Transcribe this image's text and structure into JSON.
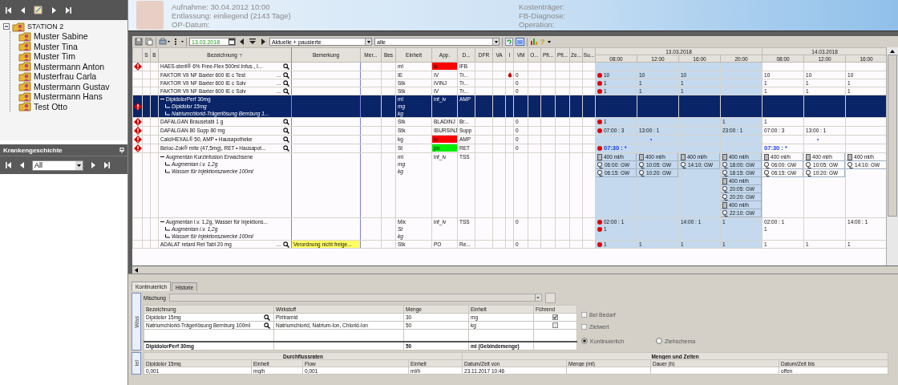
{
  "sidebar": {
    "tree": {
      "label": "STATION 2",
      "expanded": true,
      "children": [
        {
          "label": "Muster Sabine"
        },
        {
          "label": "Muster Tina"
        },
        {
          "label": "Muster Tim"
        },
        {
          "label": "Mustermann Anton"
        },
        {
          "label": "Musterfrau Carla"
        },
        {
          "label": "Mustermann Gustav"
        },
        {
          "label": "Mustermann Hans"
        },
        {
          "label": "Test Otto"
        }
      ]
    }
  },
  "history_panel": {
    "title": "Krankengeschichte",
    "filter": "All"
  },
  "header": {
    "fields_left": [
      "Aufnahme: 30.04.2012 10:00",
      "Entlassung: einliegend (2143 Tage)",
      "OP-Datum:"
    ],
    "fields_right": [
      "Kostenträger:",
      "FB-Diagnose:",
      "Operation:"
    ]
  },
  "toolbar": {
    "date": "13.03.2018",
    "status_filter": "Aktuelle + pausierte",
    "type_filter": "alle",
    "help": "?"
  },
  "grid": {
    "columns": [
      "S",
      "B",
      "Bezeichnung",
      "Bemerkung",
      "Mer...",
      "Bes",
      "Einheit",
      "App.",
      "D...",
      "DFR",
      "VA",
      "I",
      "VM",
      "O...",
      "Pfl...",
      "Pfl...",
      "Ze...",
      "Su..."
    ],
    "days": [
      {
        "date": "13.03.2018",
        "current": true,
        "times": [
          "08:00",
          "12:00",
          "16:00",
          "20:00"
        ]
      },
      {
        "date": "14.03.2018",
        "current": false,
        "times": [
          "08:00",
          "12:00",
          "16:00"
        ]
      }
    ],
    "rows": [
      {
        "alert": true,
        "selected": false,
        "drop": false,
        "lines": [
          {
            "kind": "main",
            "name": "HAES-steril® 6% Free-Flex 500ml Infus., I...",
            "unit": "ml"
          }
        ],
        "search": true,
        "route": {
          "text": "iv",
          "color": "#ff0000"
        },
        "form": "IFB",
        "cells": [
          null,
          null,
          null,
          null,
          null,
          null,
          null
        ]
      },
      {
        "alert": false,
        "selected": false,
        "drop": true,
        "lines": [
          {
            "kind": "main",
            "name": "FAKTOR VII NF Baxter 600 IE c Test",
            "unit": "IE"
          }
        ],
        "more": "...",
        "search": true,
        "route": {
          "text": "IV"
        },
        "form": "Tr...",
        "vm": "0",
        "cells": [
          [
            {
              "kind": "dot",
              "text": "10"
            }
          ],
          [
            {
              "kind": "plain",
              "text": "10"
            }
          ],
          [
            {
              "kind": "plain",
              "text": "10"
            }
          ],
          null,
          [
            {
              "kind": "plain",
              "text": "10"
            }
          ],
          [
            {
              "kind": "plain",
              "text": "10"
            }
          ],
          [
            {
              "kind": "plain",
              "text": "10"
            }
          ]
        ]
      },
      {
        "alert": false,
        "selected": false,
        "drop": false,
        "lines": [
          {
            "kind": "main",
            "name": "FAKTOR VII NF Baxter 600 IE c Solv",
            "unit": "Stk"
          }
        ],
        "more": "...",
        "search": true,
        "route": {
          "text": "IVINJ"
        },
        "form": "Tr...",
        "vm": "0",
        "cells": [
          [
            {
              "kind": "dot",
              "text": "1"
            }
          ],
          [
            {
              "kind": "plain",
              "text": "1"
            }
          ],
          [
            {
              "kind": "plain",
              "text": "1"
            }
          ],
          null,
          [
            {
              "kind": "plain",
              "text": "1"
            }
          ],
          [
            {
              "kind": "plain",
              "text": "1"
            }
          ],
          [
            {
              "kind": "plain",
              "text": "1"
            }
          ]
        ]
      },
      {
        "alert": false,
        "selected": false,
        "drop": false,
        "lines": [
          {
            "kind": "main",
            "name": "FAKTOR VII NF Baxter 600 IE c Solv",
            "unit": "Stk"
          }
        ],
        "more": "...",
        "search": true,
        "route": {
          "text": "IV"
        },
        "form": "Tr...",
        "vm": "0",
        "cells": [
          [
            {
              "kind": "dot",
              "text": "1"
            }
          ],
          [
            {
              "kind": "plain",
              "text": "1"
            }
          ],
          [
            {
              "kind": "plain",
              "text": "1"
            }
          ],
          null,
          [
            {
              "kind": "plain",
              "text": "1"
            }
          ],
          [
            {
              "kind": "plain",
              "text": "1"
            }
          ],
          [
            {
              "kind": "plain",
              "text": "1"
            }
          ]
        ]
      },
      {
        "alert": true,
        "selected": true,
        "drop": false,
        "expanded": true,
        "lines": [
          {
            "kind": "main",
            "name": "DipidolorPerf 30mg",
            "unit": "ml"
          },
          {
            "kind": "component",
            "name": "Dipidolor 15mg",
            "unit": "mg"
          },
          {
            "kind": "component",
            "name": "Natriumchlorid-Trägerlösung Bernburg 1...",
            "unit": "kg"
          }
        ],
        "search": false,
        "route": {
          "text": "inf_iv"
        },
        "form": "AMP",
        "cells": [
          null,
          null,
          null,
          null,
          null,
          null,
          null
        ]
      },
      {
        "alert": true,
        "selected": false,
        "drop": false,
        "lines": [
          {
            "kind": "main",
            "name": "DAFALGAN Brausetabl 1 g",
            "unit": "Stk"
          }
        ],
        "search": true,
        "route": {
          "text": "BLADINJ"
        },
        "form": "Br...",
        "vm": "0",
        "cells": [
          [
            {
              "kind": "dot",
              "text": "1"
            }
          ],
          null,
          null,
          [
            {
              "kind": "plain",
              "text": "1"
            }
          ],
          [
            {
              "kind": "plain",
              "text": "1"
            }
          ],
          null,
          null
        ]
      },
      {
        "alert": true,
        "selected": false,
        "drop": false,
        "lines": [
          {
            "kind": "main",
            "name": "DAFALGAN 80 Supp 80 mg",
            "unit": "Stk"
          }
        ],
        "search": true,
        "route": {
          "text": "IBURSINJ"
        },
        "form": "Supp",
        "vm": "0",
        "cells": [
          [
            {
              "kind": "dot",
              "text": "07:00 : 3"
            }
          ],
          [
            {
              "kind": "plain",
              "text": "13:00 : 1"
            }
          ],
          null,
          [
            {
              "kind": "plain",
              "text": "23:00 : 1"
            }
          ],
          [
            {
              "kind": "plain",
              "text": "07:00 : 3"
            }
          ],
          [
            {
              "kind": "plain",
              "text": "13:00 : 1"
            }
          ],
          null
        ]
      },
      {
        "alert": true,
        "selected": false,
        "drop": false,
        "lines": [
          {
            "kind": "main",
            "name": "CalciHEXAL® 50, AMP • Hausapotheke",
            "unit": "kg"
          }
        ],
        "search": true,
        "route": {
          "text": "iv",
          "color": "#ff0000"
        },
        "form": "AMP",
        "vm": "0",
        "cells": [
          null,
          [
            {
              "kind": "mark",
              "text": "•"
            }
          ],
          null,
          null,
          null,
          [
            {
              "kind": "mark",
              "text": "•"
            }
          ],
          null
        ]
      },
      {
        "alert": true,
        "selected": false,
        "drop": false,
        "lines": [
          {
            "kind": "main",
            "name": "Beloc-Zok® mite (47,5mg), RET • Hausapot...",
            "unit": "St"
          }
        ],
        "search": true,
        "route": {
          "text": "po",
          "color": "#00ee00"
        },
        "form": "RET",
        "vm": "0",
        "cells": [
          [
            {
              "kind": "dot_due",
              "text": "07:30 : *"
            }
          ],
          null,
          null,
          null,
          [
            {
              "kind": "due",
              "text": "07:30 : *"
            }
          ],
          null,
          null
        ]
      },
      {
        "alert": false,
        "selected": false,
        "drop": false,
        "expanded": true,
        "lines": [
          {
            "kind": "main",
            "name": "Augmentan Kurzinfusion Erwachsene",
            "unit": "ml"
          },
          {
            "kind": "component",
            "name": "Augmentan i.v. 1,2g",
            "unit": "mg"
          },
          {
            "kind": "component",
            "name": "Wasser für Injektionszwecke 100ml",
            "unit": "kg"
          }
        ],
        "search": false,
        "route": {
          "text": "inf_iv"
        },
        "form": "TSS",
        "cells": [
          [
            {
              "kind": "pump",
              "text": "400 ml/h"
            },
            {
              "kind": "drip",
              "text": "06:00: GW"
            },
            {
              "kind": "drip",
              "text": "06:15: GW"
            }
          ],
          [
            {
              "kind": "pump",
              "text": "400 ml/h"
            },
            {
              "kind": "drip",
              "text": "10:05: GW"
            },
            {
              "kind": "drip",
              "text": "10:20: GW"
            }
          ],
          [
            {
              "kind": "pump",
              "text": "400 ml/h"
            },
            {
              "kind": "drip",
              "text": "14:10: GW"
            }
          ],
          [
            {
              "kind": "pump",
              "text": "400 ml/h"
            },
            {
              "kind": "drip",
              "text": "18:00: GW"
            },
            {
              "kind": "drip",
              "text": "18:15: GW"
            },
            {
              "kind": "pump",
              "text": "400 ml/h"
            },
            {
              "kind": "drip",
              "text": "20:05: GW"
            },
            {
              "kind": "drip",
              "text": "20:20: GW"
            },
            {
              "kind": "pump",
              "text": "400 ml/h"
            },
            {
              "kind": "drip",
              "text": "22:10: GW"
            }
          ],
          [
            {
              "kind": "pump",
              "text": "400 ml/h"
            },
            {
              "kind": "drip",
              "text": "06:00: GW"
            },
            {
              "kind": "drip",
              "text": "06:15: GW"
            }
          ],
          [
            {
              "kind": "pump",
              "text": "400 ml/h"
            },
            {
              "kind": "drip",
              "text": "10:05: GW"
            },
            {
              "kind": "drip",
              "text": "10:20: GW"
            }
          ],
          [
            {
              "kind": "pump",
              "text": "400 ml/h"
            },
            {
              "kind": "drip",
              "text": "14:10: GW"
            }
          ]
        ]
      },
      {
        "alert": false,
        "selected": false,
        "drop": false,
        "expanded": true,
        "lines": [
          {
            "kind": "main",
            "name": "Augmentan i.v. 1,2g, Wasser für Injektions...",
            "unit": "Mix"
          },
          {
            "kind": "component",
            "name": "Augmentan i.v. 1,2g",
            "unit": "St"
          },
          {
            "kind": "component",
            "name": "Wasser für Injektionszwecke 100ml",
            "unit": "kg"
          }
        ],
        "search": false,
        "route": {
          "text": "inf_iv"
        },
        "form": "TSS",
        "vm": "0",
        "cells": [
          [
            {
              "kind": "dot",
              "text": "02:00 : 1"
            },
            {
              "kind": "dot",
              "text": "1"
            }
          ],
          null,
          [
            {
              "kind": "plain",
              "text": "14:00 : 1"
            }
          ],
          [
            {
              "kind": "plain",
              "text": "1"
            }
          ],
          [
            {
              "kind": "plain",
              "text": "02:00 : 1"
            },
            {
              "kind": "plain",
              "text": "1"
            }
          ],
          null,
          [
            {
              "kind": "plain",
              "text": "14:00 : 1"
            }
          ]
        ]
      },
      {
        "alert": false,
        "selected": false,
        "drop": false,
        "lines": [
          {
            "kind": "main",
            "name": "ADALAT retard Ret Tabl 20 mg",
            "unit": "Stk"
          }
        ],
        "more": "...",
        "search": true,
        "remark": "Verordnung nicht freige...",
        "route": {
          "text": "PO"
        },
        "form": "Re...",
        "vm": "0",
        "cells": [
          [
            {
              "kind": "dot",
              "text": "1"
            }
          ],
          [
            {
              "kind": "plain",
              "text": "1"
            }
          ],
          [
            {
              "kind": "plain",
              "text": "1"
            }
          ],
          [
            {
              "kind": "plain",
              "text": "1"
            }
          ],
          [
            {
              "kind": "plain",
              "text": "1"
            }
          ],
          [
            {
              "kind": "plain",
              "text": "1"
            }
          ],
          [
            {
              "kind": "plain",
              "text": "1"
            }
          ]
        ]
      }
    ]
  },
  "detail": {
    "tabs": [
      {
        "label": "Kontinuierlich",
        "selected": true
      },
      {
        "label": "Historie",
        "selected": false
      }
    ],
    "section_label": "Was",
    "mix_label": "Mischung",
    "components": {
      "columns": [
        "Bezeichnung",
        "Wirkstoff",
        "Menge",
        "Einheit",
        "Führend"
      ],
      "rows": [
        {
          "name": "Dipidolor 15mg",
          "substance": "Piritramid",
          "amount": "30",
          "unit": "mg",
          "leading": true
        },
        {
          "name": "Natriumchlorid-Trägerlösung Bernburg 100ml",
          "substance": "Natriumchlorid, Natrium-Ion, Chlorid-Ion",
          "amount": "50",
          "unit": "kg",
          "leading": false
        }
      ],
      "total": {
        "name": "DipidolorPerf 30mg",
        "amount": "50",
        "unit": "ml (Gebindemenge)"
      }
    },
    "options": [
      {
        "label": "Bei Bedarf",
        "checked": false
      },
      {
        "label": "Zielwert",
        "checked": false
      }
    ],
    "modes": [
      {
        "label": "Kontinuierlich",
        "selected": true
      },
      {
        "label": "Ziehschema",
        "selected": false
      }
    ],
    "rates_section_label": "iel",
    "rates": {
      "group_1": "Durchflussraten",
      "group_2": "Mengen und Zeiten",
      "columns": [
        "Dipidolor 15mg",
        "Einheit",
        "Flow",
        "Einheit",
        "Datum/Zeit von",
        "Menge (ml)",
        "Dauer (h)",
        "Datum/Zeit bis"
      ],
      "rows": [
        [
          "0,001",
          "mg/h",
          "0,001",
          "ml/h",
          "23.11.2017 10:46",
          null,
          null,
          "offen"
        ]
      ]
    }
  }
}
